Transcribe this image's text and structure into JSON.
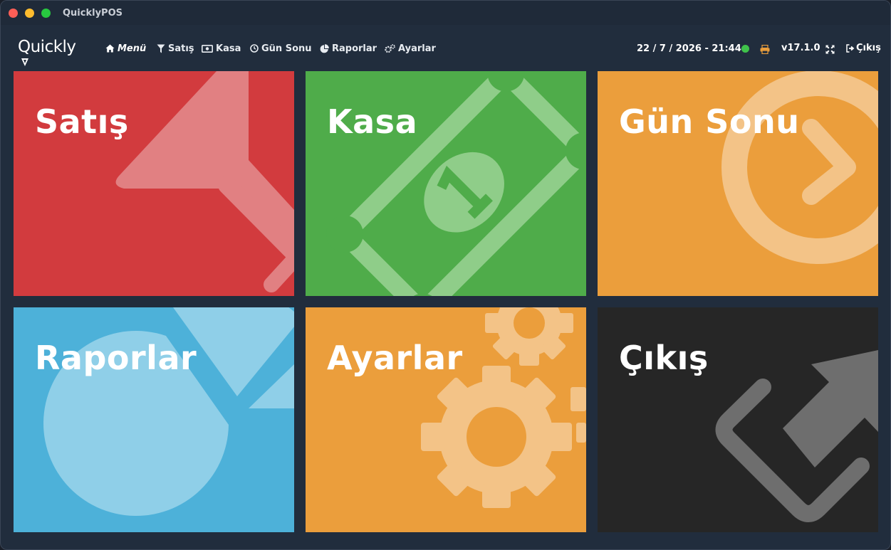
{
  "window": {
    "title": "QuicklyPOS"
  },
  "brand": {
    "logo_text": "Quickly"
  },
  "nav": {
    "items": [
      {
        "label": "Menü",
        "icon": "home-icon"
      },
      {
        "label": "Satış",
        "icon": "funnel-icon"
      },
      {
        "label": "Kasa",
        "icon": "money-icon"
      },
      {
        "label": "Gün Sonu",
        "icon": "clock-icon"
      },
      {
        "label": "Raporlar",
        "icon": "pie-chart-icon"
      },
      {
        "label": "Ayarlar",
        "icon": "gears-icon"
      }
    ],
    "active": "Menü"
  },
  "status": {
    "datetime": "22 / 7 / 2026 - 21:44",
    "connection": "online",
    "printer_icon": "printer-icon",
    "version": "v17.1.0",
    "fullscreen_icon": "expand-icon",
    "exit_label": "Çıkış"
  },
  "tiles": [
    {
      "label": "Satış",
      "icon": "funnel-icon",
      "color": "#d23b3e"
    },
    {
      "label": "Kasa",
      "icon": "money-icon",
      "color": "#4fac4a"
    },
    {
      "label": "Gün Sonu",
      "icon": "chevron-circle-icon",
      "color": "#eb9e3c"
    },
    {
      "label": "Raporlar",
      "icon": "pie-chart-icon",
      "color": "#4db1d9"
    },
    {
      "label": "Ayarlar",
      "icon": "gears-icon",
      "color": "#eb9e3c"
    },
    {
      "label": "Çıkış",
      "icon": "sign-out-icon",
      "color": "#262626"
    }
  ],
  "colors": {
    "background": "#212d3d",
    "online": "#3fc24b",
    "printer": "#eb9e3c"
  }
}
